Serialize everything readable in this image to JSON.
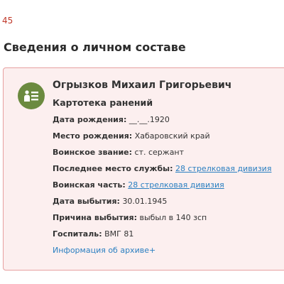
{
  "top_fragment": "45",
  "section_title": "Сведения о личном составе",
  "card": {
    "icon": "person-card-icon",
    "name": "Огрызков Михаил Григорьевич",
    "record_type": "Картотека ранений",
    "fields": [
      {
        "label": "Дата рождения:",
        "value": "__.__.1920",
        "link": false
      },
      {
        "label": "Место рождения:",
        "value": "Хабаровский край",
        "link": false
      },
      {
        "label": "Воинское звание:",
        "value": "ст. сержант",
        "link": false
      },
      {
        "label": "Последнее место службы:",
        "value": "28 стрелковая дивизия",
        "link": true
      },
      {
        "label": "Воинская часть:",
        "value": "28 стрелковая дивизия",
        "link": true
      },
      {
        "label": "Дата выбытия:",
        "value": "30.01.1945",
        "link": false
      },
      {
        "label": "Причина выбытия:",
        "value": "выбыл в 140 зсп",
        "link": false
      },
      {
        "label": "Госпиталь:",
        "value": "ВМГ 81",
        "link": false
      }
    ],
    "archive_link": "Информация об архиве+"
  },
  "colors": {
    "card_background": "#fcefef",
    "card_border": "#e7a0a0",
    "avatar": "#6b8a3f",
    "link": "#2a7fc1",
    "fragment": "#c0392b"
  }
}
